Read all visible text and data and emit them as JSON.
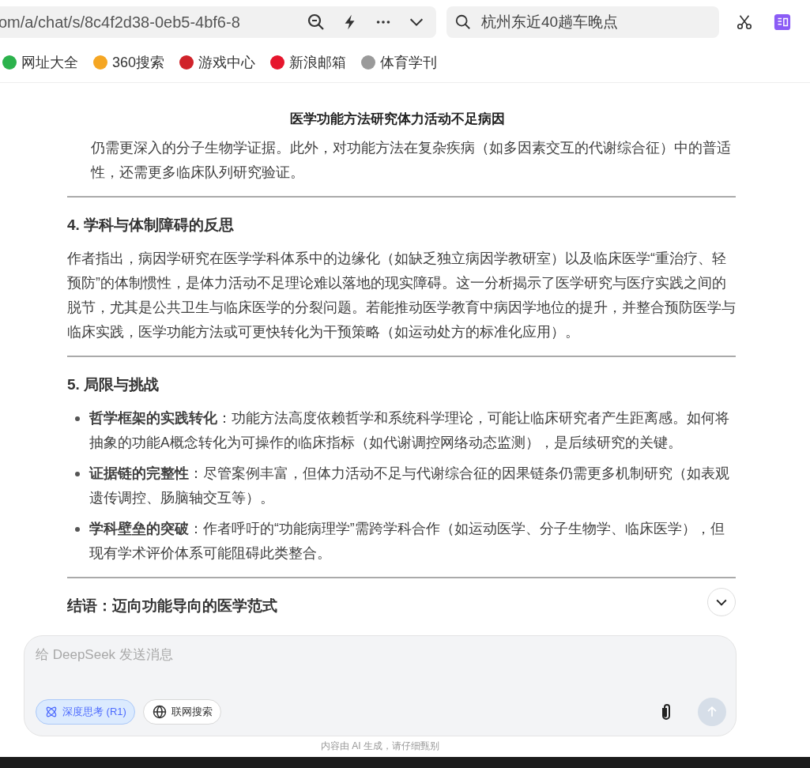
{
  "browser": {
    "address": "om/a/chat/s/8c4f2d38-0eb5-4bf6-8",
    "search": "杭州东近40趟车晚点",
    "bookmarks": [
      {
        "label": "网址大全",
        "color": "#2bb24c"
      },
      {
        "label": "360搜索",
        "color": "#f5a623"
      },
      {
        "label": "游戏中心",
        "color": "#d0232a"
      },
      {
        "label": "新浪邮箱",
        "color": "#e6162d"
      },
      {
        "label": "体育学刊",
        "color": "#9a9a9a"
      }
    ]
  },
  "chat": {
    "title": "医学功能方法研究体力活动不足病因",
    "blocks": [
      {
        "kind": "paragraph",
        "text": "仍需更深入的分子生物学证据。此外，对功能方法在复杂疾病（如多因素交互的代谢综合征）中的普适性，还需更多临床队列研究验证。"
      },
      {
        "kind": "rule"
      },
      {
        "kind": "heading",
        "text": "4. 学科与体制障碍的反思"
      },
      {
        "kind": "paragraph",
        "text": "作者指出，病因学研究在医学学科体系中的边缘化（如缺乏独立病因学教研室）以及临床医学“重治疗、轻预防”的体制惯性，是体力活动不足理论难以落地的现实障碍。这一分析揭示了医学研究与医疗实践之间的脱节，尤其是公共卫生与临床医学的分裂问题。若能推动医学教育中病因学地位的提升，并整合预防医学与临床实践，医学功能方法或可更快转化为干预策略（如运动处方的标准化应用）。"
      },
      {
        "kind": "rule"
      },
      {
        "kind": "heading",
        "text": "5. 局限与挑战"
      },
      {
        "kind": "bullets",
        "items": [
          "**哲学框架的实践转化**：功能方法高度依赖哲学和系统科学理论，可能让临床研究者产生距离感。如何将抽象的功能A概念转化为可操作的临床指标（如代谢调控网络动态监测），是后续研究的关键。",
          "**证据链的完整性**：尽管案例丰富，但体力活动不足与代谢综合征的因果链条仍需更多机制研究（如表观遗传调控、肠脑轴交互等）。",
          "**学科壁垒的突破**：作者呼吁的“功能病理学”需跨学科合作（如运动医学、分子生物学、临床医学），但现有学术评价体系可能阻碍此类整合。"
        ]
      },
      {
        "kind": "rule"
      },
      {
        "kind": "heading",
        "text": "结语：迈向功能导向的医学范式"
      }
    ],
    "input": {
      "placeholder": "给 DeepSeek 发送消息",
      "chips": [
        {
          "label": "深度思考 (R1)",
          "selected": true
        },
        {
          "label": "联网搜索",
          "selected": false
        }
      ]
    },
    "disclaimer": "内容由 AI 生成，请仔细甄别"
  }
}
